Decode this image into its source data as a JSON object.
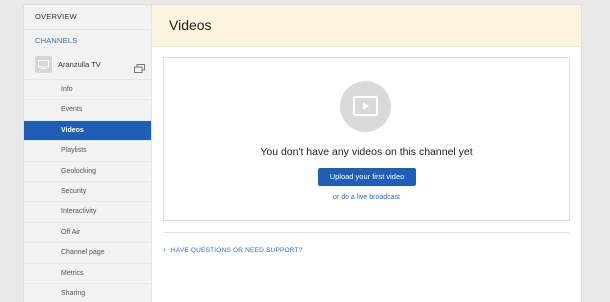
{
  "sidebar": {
    "overview": "OVERVIEW",
    "channels": "CHANNELS",
    "channel_name": "Aranzulla TV",
    "items": [
      {
        "label": "Info",
        "active": false
      },
      {
        "label": "Events",
        "active": false
      },
      {
        "label": "Videos",
        "active": true
      },
      {
        "label": "Playlists",
        "active": false
      },
      {
        "label": "Geolocking",
        "active": false
      },
      {
        "label": "Security",
        "active": false
      },
      {
        "label": "Interactivity",
        "active": false
      },
      {
        "label": "Off Air",
        "active": false
      },
      {
        "label": "Channel page",
        "active": false
      },
      {
        "label": "Metrics",
        "active": false
      },
      {
        "label": "Sharing",
        "active": false
      }
    ]
  },
  "main": {
    "title": "Videos",
    "empty_message": "You don't have any videos on this channel yet",
    "upload_button": "Upload your first video",
    "or_text": "or",
    "live_link": "do a live broadcast",
    "support_link": "HAVE QUESTIONS OR NEED SUPPORT?"
  },
  "icons": {
    "channel_thumb": "tv-icon",
    "copy": "copy-icon",
    "video_placeholder": "video-play-icon",
    "support_chevron": "chevron-right-icon"
  },
  "colors": {
    "accent": "#1f5fb8",
    "link": "#2c6fc3",
    "header_bg": "#fcf4df",
    "sidebar_bg": "#f2f2f2"
  }
}
